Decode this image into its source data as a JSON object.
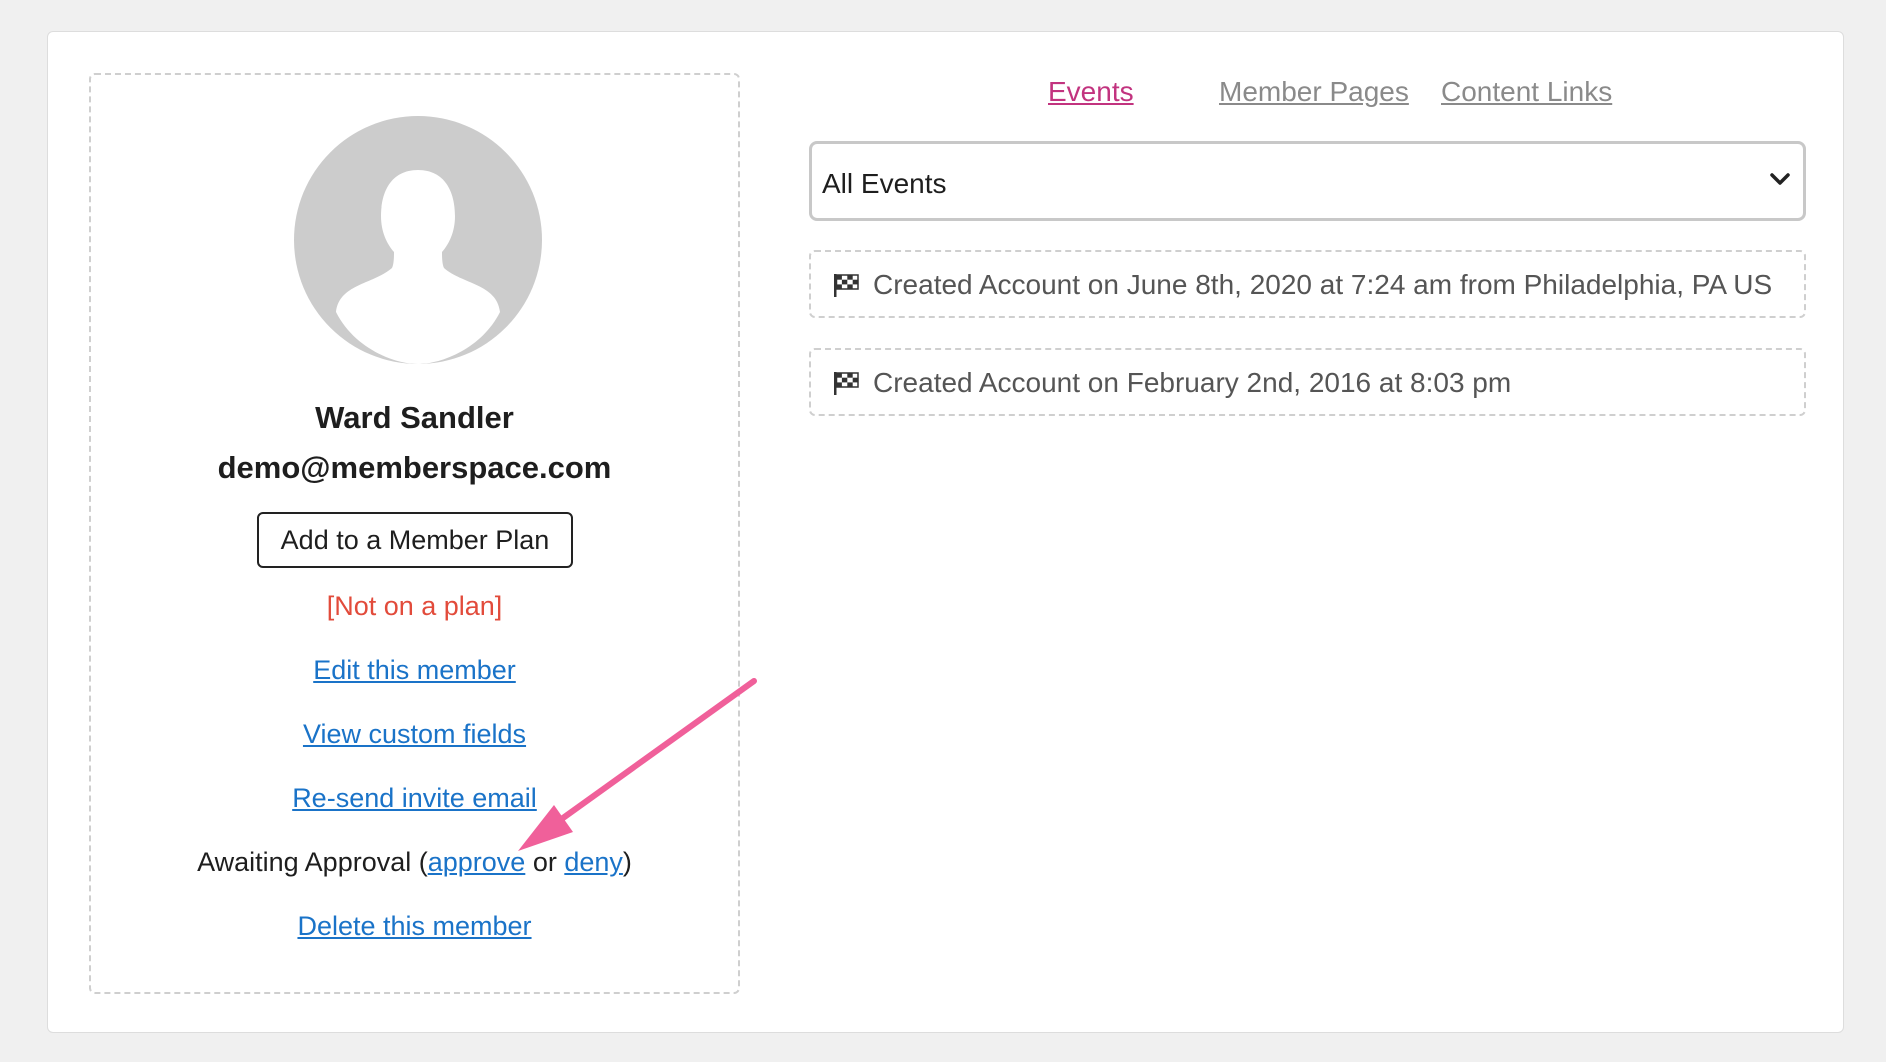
{
  "member": {
    "name": "Ward Sandler",
    "email": "demo@memberspace.com",
    "add_plan_label": "Add to a Member Plan",
    "plan_status": "[Not on a plan]",
    "edit_label": "Edit this member",
    "custom_fields_label": "View custom fields",
    "resend_label": "Re-send invite email",
    "approval_prefix": "Awaiting Approval (",
    "approve_label": "approve",
    "approval_or": " or ",
    "deny_label": "deny",
    "approval_suffix": ")",
    "delete_label": "Delete this member"
  },
  "tabs": [
    {
      "label": "Events",
      "active": true
    },
    {
      "label": "Member Pages",
      "active": false
    },
    {
      "label": "Content Links",
      "active": false
    }
  ],
  "filter": {
    "selected": "All Events"
  },
  "events": [
    {
      "icon": "checkered-flag-icon",
      "text": "Created Account on June 8th, 2020 at 7:24 am from Philadelphia, PA US"
    },
    {
      "icon": "checkered-flag-icon",
      "text": "Created Account on February 2nd, 2016 at 8:03 pm"
    }
  ],
  "colors": {
    "active_tab": "#c2337f",
    "inactive_tab": "#8a8a8a",
    "link": "#1a73c8",
    "plan_status": "#e24b3b",
    "annotation_arrow": "#f0609a"
  }
}
